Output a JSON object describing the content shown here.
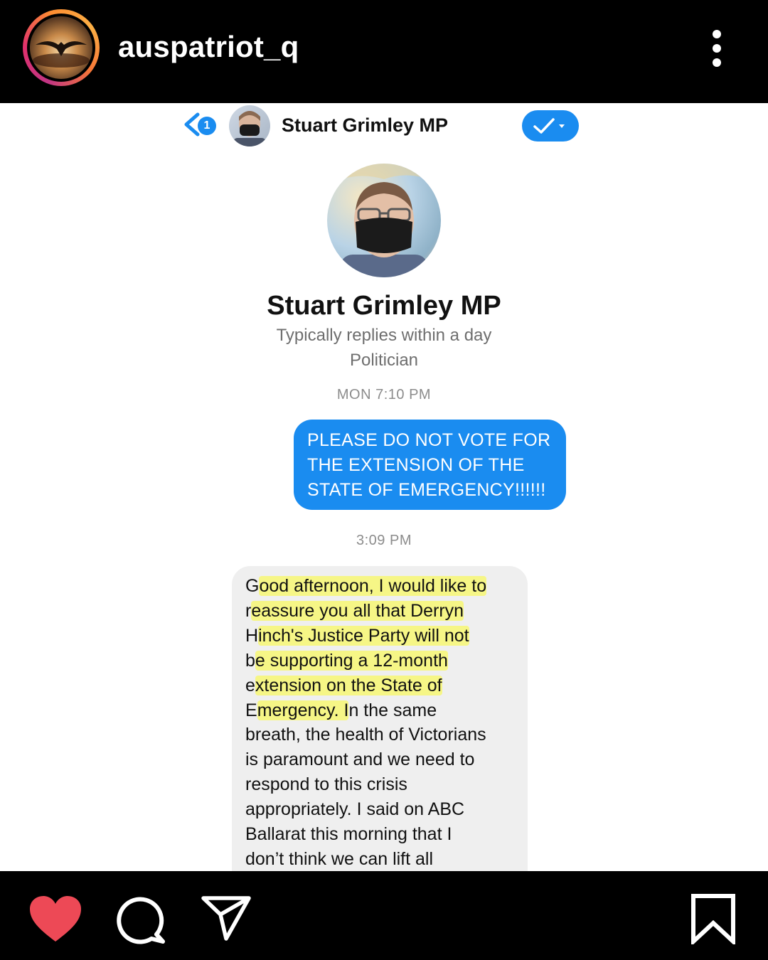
{
  "header": {
    "username": "auspatriot_q",
    "avatar_icon": "eagle-sunset-avatar",
    "menu_icon": "more-vertical-icon"
  },
  "messenger": {
    "unread_count": "1",
    "contact_name": "Stuart Grimley MP",
    "accent_color": "#1a8cf0"
  },
  "profile": {
    "name": "Stuart Grimley MP",
    "response_time": "Typically replies within a day",
    "category": "Politician"
  },
  "conversation": {
    "timestamp_1": "MON 7:10 PM",
    "sent_message_lines": [
      "PLEASE DO NOT VOTE FOR",
      "THE EXTENSION OF THE",
      "STATE OF EMERGENCY!!!!!!"
    ],
    "timestamp_2": "3:09 PM",
    "received_message_lines": [
      [
        "G",
        "ood afternoon, I would like to",
        ""
      ],
      [
        "r",
        "eassure you all that Derryn",
        ""
      ],
      [
        "H",
        "inch's Justice Party will not",
        ""
      ],
      [
        "b",
        "e supporting a 12-month",
        ""
      ],
      [
        "e",
        "xtension on the State of",
        ""
      ],
      [
        "E",
        "mergency. I",
        "n the same"
      ],
      [
        "",
        "",
        "breath, the health of Victorians"
      ],
      [
        "",
        "",
        "is paramount and we need to"
      ],
      [
        "",
        "",
        "respond to this crisis"
      ],
      [
        "",
        "",
        "appropriately. I said on ABC"
      ],
      [
        "",
        "",
        "Ballarat this morning that I"
      ],
      [
        "",
        "",
        "don’t think we can lift all"
      ]
    ],
    "highlight_color": "#f5f54a"
  },
  "footer": {
    "like_icon": "heart-icon",
    "like_color": "#ed4956",
    "comment_icon": "comment-icon",
    "share_icon": "send-icon",
    "save_icon": "bookmark-icon"
  }
}
